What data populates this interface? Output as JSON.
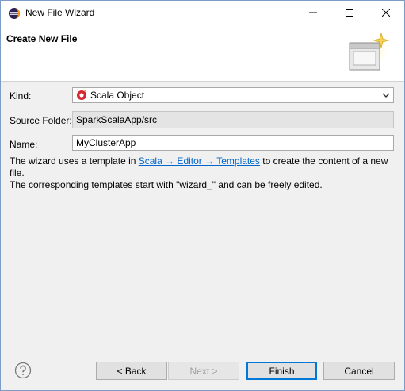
{
  "window": {
    "title": "New File Wizard"
  },
  "titlebar": {
    "min_glyph": "",
    "max_glyph": "",
    "close_glyph": ""
  },
  "banner": {
    "title": "Create New File"
  },
  "form": {
    "kind_label": "Kind:",
    "kind_value": "Scala Object",
    "source_folder_label": "Source Folder:",
    "source_folder_value": "SparkScalaApp/src",
    "name_label": "Name:",
    "name_value": "MyClusterApp"
  },
  "description": {
    "before_link": "The wizard uses a template in ",
    "link": "Scala → Editor → Templates",
    "after_link": " to create the content of a new file.",
    "line2": "The corresponding templates start with \"wizard_\" and can be freely edited."
  },
  "buttons": {
    "back": "< Back",
    "next": "Next >",
    "finish": "Finish",
    "cancel": "Cancel"
  },
  "icons": {
    "app": "eclipse-icon",
    "kind": "scala-object-icon",
    "help": "help-icon",
    "wizard_banner": "new-file-wizard-icon"
  },
  "colors": {
    "link": "#0066cc",
    "default_button_border": "#0078d7"
  }
}
